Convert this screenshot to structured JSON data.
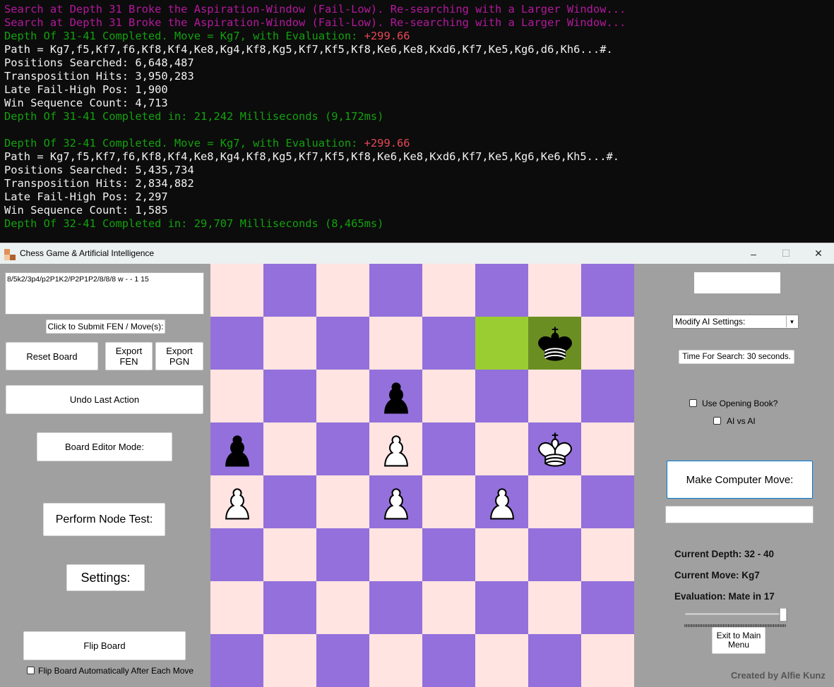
{
  "console": {
    "lines": [
      {
        "parts": [
          {
            "t": "Search at Depth 31 Broke the Aspiration-Window (Fail-Low). Re-searching with a Larger Window...",
            "c": "magenta"
          }
        ]
      },
      {
        "parts": [
          {
            "t": "Search at Depth 31 Broke the Aspiration-Window (Fail-Low). Re-searching with a Larger Window...",
            "c": "magenta"
          }
        ]
      },
      {
        "parts": [
          {
            "t": "Depth Of 31-41 Completed. Move = Kg7, with Evaluation: ",
            "c": "green"
          },
          {
            "t": "+299.66",
            "c": "red"
          }
        ]
      },
      {
        "parts": [
          {
            "t": "Path = Kg7,f5,Kf7,f6,Kf8,Kf4,Ke8,Kg4,Kf8,Kg5,Kf7,Kf5,Kf8,Ke6,Ke8,Kxd6,Kf7,Ke5,Kg6,d6,Kh6...#.",
            "c": "white"
          }
        ]
      },
      {
        "parts": [
          {
            "t": "Positions Searched: 6,648,487",
            "c": "white"
          }
        ]
      },
      {
        "parts": [
          {
            "t": "Transposition Hits: 3,950,283",
            "c": "white"
          }
        ]
      },
      {
        "parts": [
          {
            "t": "Late Fail-High Pos: 1,900",
            "c": "white"
          }
        ]
      },
      {
        "parts": [
          {
            "t": "Win Sequence Count: 4,713",
            "c": "white"
          }
        ]
      },
      {
        "parts": [
          {
            "t": "Depth Of 31-41 Completed in: 21,242 Milliseconds (9,172ms)",
            "c": "green"
          }
        ]
      },
      {
        "parts": []
      },
      {
        "parts": [
          {
            "t": "Depth Of 32-41 Completed. Move = Kg7, with Evaluation: ",
            "c": "green"
          },
          {
            "t": "+299.66",
            "c": "red"
          }
        ]
      },
      {
        "parts": [
          {
            "t": "Path = Kg7,f5,Kf7,f6,Kf8,Kf4,Ke8,Kg4,Kf8,Kg5,Kf7,Kf5,Kf8,Ke6,Ke8,Kxd6,Kf7,Ke5,Kg6,Ke6,Kh5...#.",
            "c": "white"
          }
        ]
      },
      {
        "parts": [
          {
            "t": "Positions Searched: 5,435,734",
            "c": "white"
          }
        ]
      },
      {
        "parts": [
          {
            "t": "Transposition Hits: 2,834,882",
            "c": "white"
          }
        ]
      },
      {
        "parts": [
          {
            "t": "Late Fail-High Pos: 2,297",
            "c": "white"
          }
        ]
      },
      {
        "parts": [
          {
            "t": "Win Sequence Count: 1,585",
            "c": "white"
          }
        ]
      },
      {
        "parts": [
          {
            "t": "Depth Of 32-41 Completed in: 29,707 Milliseconds (8,465ms)",
            "c": "green"
          }
        ]
      }
    ]
  },
  "window": {
    "title": "Chess Game & Artificial Intelligence",
    "minimize_glyph": "–",
    "maximize_glyph": "☐",
    "close_glyph": "✕"
  },
  "left_panel": {
    "fen_value": "8/5k2/3p4/p2P1K2/P2P1P2/8/8/8 w - - 1 15",
    "submit_label": "Click to Submit FEN / Move(s):",
    "reset_label": "Reset Board",
    "export_fen_label": "Export\nFEN",
    "export_pgn_label": "Export\nPGN",
    "undo_label": "Undo Last Action",
    "editor_label": "Board Editor Mode:",
    "node_test_label": "Perform Node Test:",
    "settings_label": "Settings:",
    "flip_label": "Flip Board",
    "flip_auto_label": "Flip Board Automatically After Each Move"
  },
  "right_panel": {
    "ai_settings_selected": "Modify AI Settings:",
    "time_label": "Time For Search: 30 seconds.",
    "time_slider_fraction": 1.0,
    "opening_book_label": "Use Opening Book?",
    "ai_vs_ai_label": "AI vs AI",
    "make_move_label": "Make Computer Move:",
    "current_depth": "Current Depth: 32 - 40",
    "current_move": "Current Move: Kg7",
    "evaluation": "Evaluation: Mate in 17",
    "exit_label": "Exit to Main\nMenu",
    "credit": "Created by Alfie Kunz"
  },
  "board": {
    "light_color": "#ffe4e1",
    "dark_color": "#9370db",
    "highlight_from_color": "#9acd32",
    "highlight_to_color": "#6b8e23",
    "highlight_from": "f7",
    "highlight_to": "g7",
    "pieces": [
      {
        "square": "g7",
        "type": "king",
        "color": "black"
      },
      {
        "square": "d6",
        "type": "pawn",
        "color": "black"
      },
      {
        "square": "a5",
        "type": "pawn",
        "color": "black"
      },
      {
        "square": "d5",
        "type": "pawn",
        "color": "white"
      },
      {
        "square": "g5",
        "type": "king",
        "color": "white"
      },
      {
        "square": "a4",
        "type": "pawn",
        "color": "white"
      },
      {
        "square": "d4",
        "type": "pawn",
        "color": "white"
      },
      {
        "square": "f4",
        "type": "pawn",
        "color": "white"
      }
    ]
  }
}
